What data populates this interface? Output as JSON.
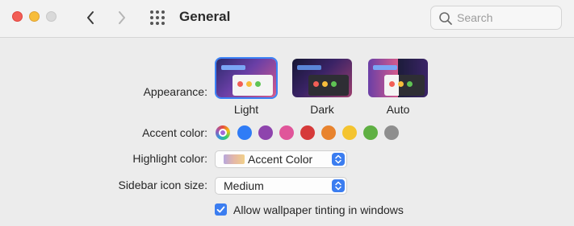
{
  "window": {
    "title": "General"
  },
  "search": {
    "placeholder": "Search"
  },
  "appearance": {
    "label": "Appearance:",
    "options": [
      {
        "label": "Light",
        "selected": true
      },
      {
        "label": "Dark",
        "selected": false
      },
      {
        "label": "Auto",
        "selected": false
      }
    ]
  },
  "accent": {
    "label": "Accent color:",
    "colors": [
      "multicolor",
      "#2f7cf6",
      "#8e44ad",
      "#e0559a",
      "#d63a3a",
      "#e8832e",
      "#f4c430",
      "#5fb043",
      "#8e8e8e"
    ],
    "selected": "multicolor"
  },
  "highlight": {
    "label": "Highlight color:",
    "value": "Accent Color"
  },
  "sidebar_icon_size": {
    "label": "Sidebar icon size:",
    "value": "Medium"
  },
  "wallpaper_tinting": {
    "label": "Allow wallpaper tinting in windows",
    "checked": true
  }
}
